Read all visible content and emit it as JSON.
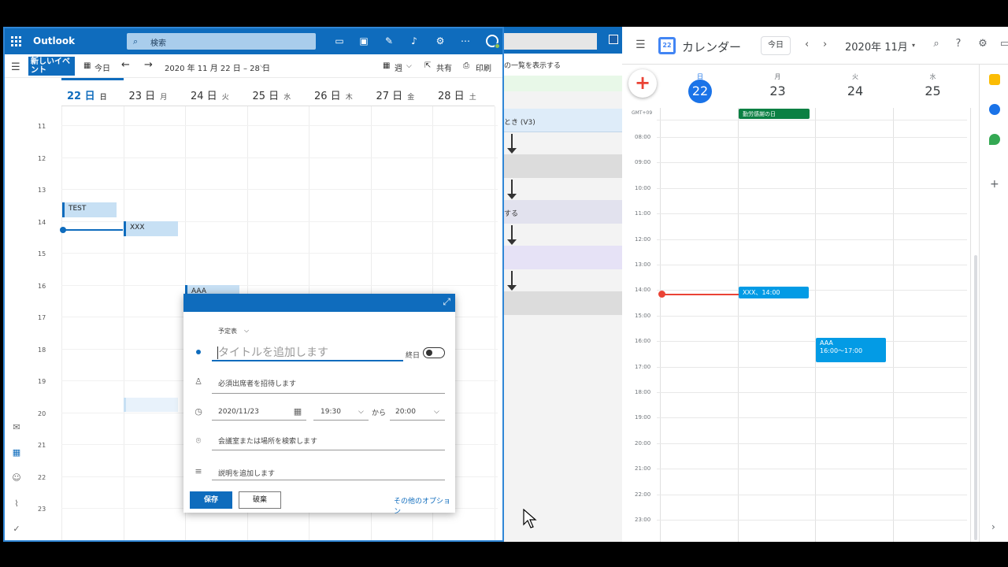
{
  "outlook": {
    "app_title": "Outlook",
    "search_placeholder": "検索",
    "new_event_label": "新しいイベント",
    "today_label": "今日",
    "date_range": "2020 年 11 月 22 日 – 28 日",
    "view_label": "週",
    "share_label": "共有",
    "print_label": "印刷",
    "days": [
      {
        "num": "22 日",
        "dow": "日"
      },
      {
        "num": "23 日",
        "dow": "月"
      },
      {
        "num": "24 日",
        "dow": "火"
      },
      {
        "num": "25 日",
        "dow": "水"
      },
      {
        "num": "26 日",
        "dow": "木"
      },
      {
        "num": "27 日",
        "dow": "金"
      },
      {
        "num": "28 日",
        "dow": "土"
      }
    ],
    "hours": [
      "11",
      "12",
      "13",
      "14",
      "15",
      "16",
      "17",
      "18",
      "19",
      "20",
      "21",
      "22",
      "23"
    ],
    "events": {
      "test": "TEST",
      "xxx": "XXX",
      "aaa": "AAA"
    },
    "popup": {
      "calendar_label": "予定表",
      "title_placeholder": "タイトルを追加します",
      "allday_label": "終日",
      "attendees_placeholder": "必須出席者を招待します",
      "date_value": "2020/11/23",
      "start_time": "19:30",
      "to_label": "から",
      "end_time": "20:00",
      "location_placeholder": "会議室または場所を検索します",
      "description_placeholder": "説明を追加します",
      "save_label": "保存",
      "discard_label": "破棄",
      "more_options_label": "その他のオプション"
    }
  },
  "middle": {
    "subheader": "の一覧を表示する",
    "card1": "とき (V3)",
    "card2": "する"
  },
  "gcal": {
    "app_title": "カレンダー",
    "today_label": "今日",
    "month_label": "2020年 11月",
    "timezone": "GMT+09",
    "days": [
      {
        "dow": "日",
        "num": "22"
      },
      {
        "dow": "月",
        "num": "23"
      },
      {
        "dow": "火",
        "num": "24"
      },
      {
        "dow": "水",
        "num": "25"
      }
    ],
    "holiday": "勤労感謝の日",
    "hours": [
      "08:00",
      "09:00",
      "10:00",
      "11:00",
      "12:00",
      "13:00",
      "14:00",
      "15:00",
      "16:00",
      "17:00",
      "18:00",
      "19:00",
      "20:00",
      "21:00",
      "22:00",
      "23:00"
    ],
    "event_xxx": "XXX、14:00",
    "event_aaa_title": "AAA",
    "event_aaa_time": "16:00～17:00"
  }
}
